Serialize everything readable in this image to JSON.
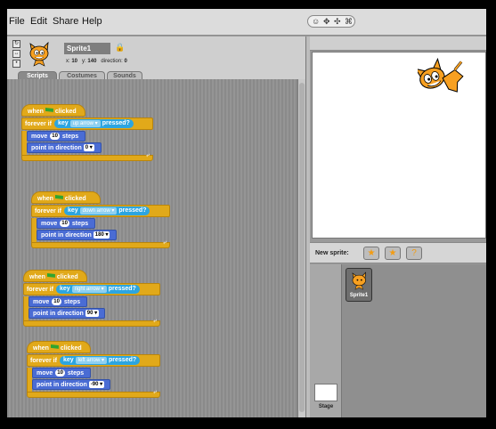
{
  "menu": {
    "file": "File",
    "edit": "Edit",
    "share": "Share",
    "help": "Help"
  },
  "toolbar": {
    "icons": [
      "person-icon",
      "grow-icon",
      "shrink-icon",
      "shrink-all-icon"
    ]
  },
  "sprite": {
    "name": "Sprite1",
    "x_label": "x:",
    "x_value": "10",
    "y_label": "y:",
    "y_value": "140",
    "direction_label": "direction:",
    "direction_value": "0"
  },
  "tabs": {
    "scripts": "Scripts",
    "costumes": "Costumes",
    "sounds": "Sounds"
  },
  "blocks": {
    "when": "when",
    "clicked": "clicked",
    "forever_if": "forever if",
    "key": "key",
    "pressed": "pressed?",
    "move": "move",
    "steps": "steps",
    "point_in_direction": "point in direction"
  },
  "scripts": [
    {
      "key": "up arrow",
      "steps": "10",
      "direction": "0"
    },
    {
      "key": "down arrow",
      "steps": "10",
      "direction": "180"
    },
    {
      "key": "right arrow",
      "steps": "10",
      "direction": "90"
    },
    {
      "key": "left arrow",
      "steps": "10",
      "direction": "-90"
    }
  ],
  "library": {
    "new_sprite_label": "New sprite:",
    "sprite_tile": "Sprite1",
    "stage_label": "Stage"
  },
  "colors": {
    "control": "#e1a91a",
    "motion": "#4a6cd4",
    "sensing": "#2ca5e0"
  }
}
